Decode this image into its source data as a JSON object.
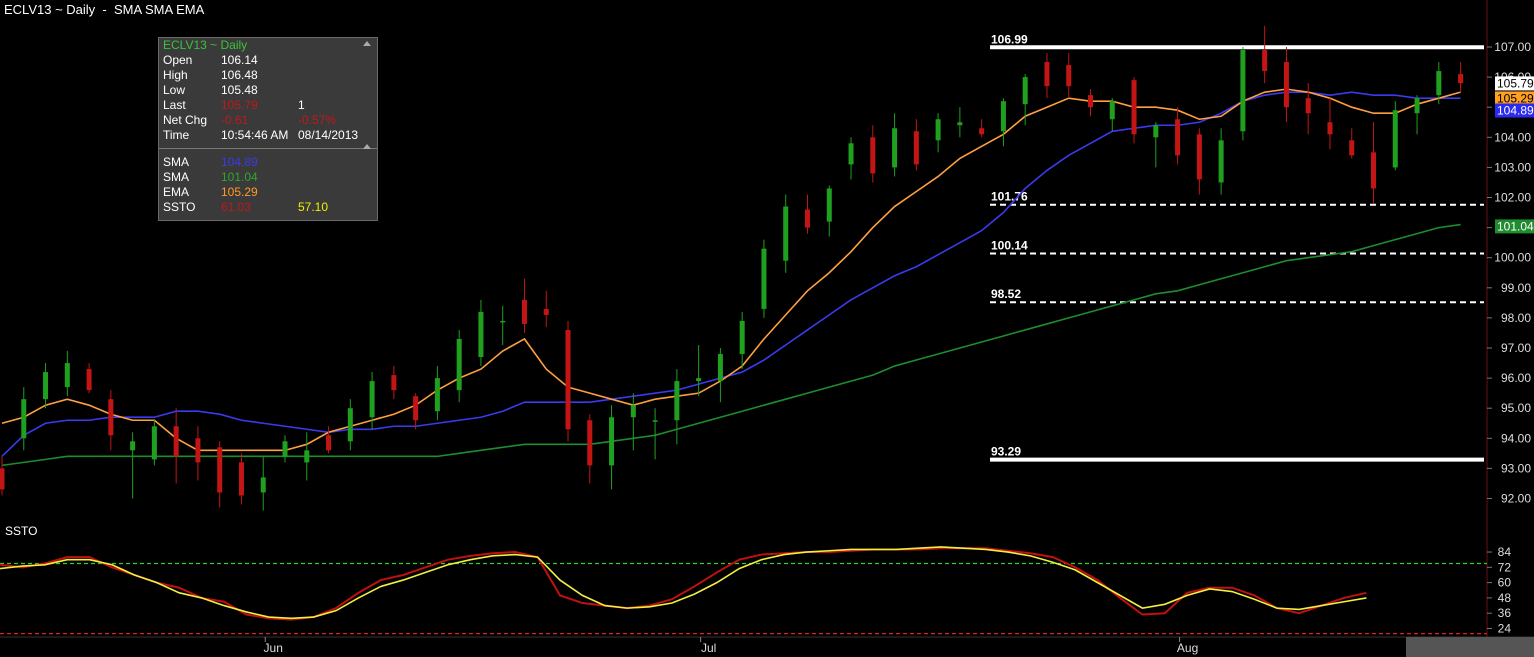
{
  "window": {
    "title": "ECLV13 ~ Daily  -  SMA SMA EMA"
  },
  "quote_box": {
    "header": "ECLV13 ~ Daily",
    "rows": [
      {
        "label": "Open",
        "v1": "106.14",
        "v2": ""
      },
      {
        "label": "High",
        "v1": "106.48",
        "v2": ""
      },
      {
        "label": "Low",
        "v1": "105.48",
        "v2": ""
      },
      {
        "label": "Last",
        "v1": "105.79",
        "v2": "1"
      },
      {
        "label": "Net Chg",
        "v1": "-0.61",
        "v2": "-0.57%"
      },
      {
        "label": "Time",
        "v1": "10:54:46 AM",
        "v2": "08/14/2013"
      }
    ],
    "studies": [
      {
        "label": "SMA",
        "v1": "104.89",
        "v2": ""
      },
      {
        "label": "SMA",
        "v1": "101.04",
        "v2": ""
      },
      {
        "label": "EMA",
        "v1": "105.29",
        "v2": ""
      },
      {
        "label": "SSTO",
        "v1": "61.03",
        "v2": "57.10"
      }
    ]
  },
  "ssto_panel": {
    "label": "SSTO"
  },
  "colors": {
    "up": "#1fa01f",
    "down": "#c41515",
    "sma_fast": "#3a3af0",
    "sma_slow": "#1f8c2e",
    "ema": "#ffa040",
    "ssto_k": "#c01010",
    "ssto_d": "#f0f040",
    "ob_line": "#2ed02e",
    "os_line": "#e02020"
  },
  "chart_data": [
    {
      "type": "candlestick",
      "title": "ECLV13 ~ Daily",
      "ylim": [
        91.3,
        107.9
      ],
      "x_labels": [
        {
          "i": 12,
          "label": "Jun"
        },
        {
          "i": 32,
          "label": "Jul"
        },
        {
          "i": 54,
          "label": "Aug"
        }
      ],
      "y_ticks": [
        92,
        93,
        94,
        95,
        96,
        97,
        98,
        99,
        100,
        101,
        102,
        103,
        104,
        105,
        106,
        107
      ],
      "candles": [
        {
          "o": 93.0,
          "h": 93.4,
          "l": 92.1,
          "c": 92.3
        },
        {
          "o": 94.0,
          "h": 95.7,
          "l": 93.6,
          "c": 95.3
        },
        {
          "o": 95.3,
          "h": 96.5,
          "l": 95.0,
          "c": 96.2
        },
        {
          "o": 95.7,
          "h": 96.9,
          "l": 95.4,
          "c": 96.5
        },
        {
          "o": 96.3,
          "h": 96.5,
          "l": 95.5,
          "c": 95.6
        },
        {
          "o": 95.3,
          "h": 95.6,
          "l": 93.6,
          "c": 94.1
        },
        {
          "o": 93.6,
          "h": 94.2,
          "l": 92.0,
          "c": 93.9
        },
        {
          "o": 93.3,
          "h": 94.6,
          "l": 93.1,
          "c": 94.4
        },
        {
          "o": 94.4,
          "h": 95.0,
          "l": 92.5,
          "c": 93.4
        },
        {
          "o": 94.0,
          "h": 94.4,
          "l": 92.6,
          "c": 93.2
        },
        {
          "o": 93.7,
          "h": 93.9,
          "l": 91.7,
          "c": 92.2
        },
        {
          "o": 93.2,
          "h": 93.5,
          "l": 91.8,
          "c": 92.1
        },
        {
          "o": 92.2,
          "h": 93.4,
          "l": 91.6,
          "c": 92.7
        },
        {
          "o": 93.4,
          "h": 94.1,
          "l": 93.2,
          "c": 93.9
        },
        {
          "o": 93.2,
          "h": 94.2,
          "l": 92.6,
          "c": 93.6
        },
        {
          "o": 94.1,
          "h": 94.4,
          "l": 93.5,
          "c": 93.6
        },
        {
          "o": 93.9,
          "h": 95.3,
          "l": 93.6,
          "c": 95.0
        },
        {
          "o": 94.7,
          "h": 96.2,
          "l": 94.3,
          "c": 95.9
        },
        {
          "o": 96.1,
          "h": 96.4,
          "l": 95.3,
          "c": 95.6
        },
        {
          "o": 95.4,
          "h": 95.5,
          "l": 94.3,
          "c": 94.6
        },
        {
          "o": 94.9,
          "h": 96.4,
          "l": 94.6,
          "c": 96.0
        },
        {
          "o": 95.6,
          "h": 97.6,
          "l": 95.2,
          "c": 97.3
        },
        {
          "o": 96.7,
          "h": 98.6,
          "l": 96.4,
          "c": 98.2
        },
        {
          "o": 97.9,
          "h": 98.4,
          "l": 97.1,
          "c": 97.9
        },
        {
          "o": 98.6,
          "h": 99.3,
          "l": 97.5,
          "c": 97.8
        },
        {
          "o": 98.3,
          "h": 98.9,
          "l": 97.7,
          "c": 98.1
        },
        {
          "o": 97.6,
          "h": 97.9,
          "l": 93.9,
          "c": 94.3
        },
        {
          "o": 94.6,
          "h": 94.8,
          "l": 92.5,
          "c": 93.1
        },
        {
          "o": 93.1,
          "h": 95.1,
          "l": 92.3,
          "c": 94.7
        },
        {
          "o": 94.7,
          "h": 95.5,
          "l": 93.6,
          "c": 95.1
        },
        {
          "o": 94.6,
          "h": 95.0,
          "l": 93.3,
          "c": 94.6
        },
        {
          "o": 94.6,
          "h": 96.3,
          "l": 93.8,
          "c": 95.9
        },
        {
          "o": 95.9,
          "h": 97.1,
          "l": 95.4,
          "c": 96.0
        },
        {
          "o": 95.9,
          "h": 97.0,
          "l": 95.2,
          "c": 96.8
        },
        {
          "o": 96.8,
          "h": 98.2,
          "l": 96.3,
          "c": 97.9
        },
        {
          "o": 98.3,
          "h": 100.6,
          "l": 98.0,
          "c": 100.3
        },
        {
          "o": 99.9,
          "h": 102.1,
          "l": 99.5,
          "c": 101.7
        },
        {
          "o": 101.6,
          "h": 102.1,
          "l": 100.8,
          "c": 101.0
        },
        {
          "o": 101.2,
          "h": 102.4,
          "l": 100.7,
          "c": 102.3
        },
        {
          "o": 103.1,
          "h": 104.0,
          "l": 102.6,
          "c": 103.8
        },
        {
          "o": 104.0,
          "h": 104.4,
          "l": 102.5,
          "c": 102.8
        },
        {
          "o": 103.0,
          "h": 104.8,
          "l": 102.7,
          "c": 104.3
        },
        {
          "o": 104.2,
          "h": 104.6,
          "l": 102.9,
          "c": 103.1
        },
        {
          "o": 103.9,
          "h": 104.8,
          "l": 103.5,
          "c": 104.6
        },
        {
          "o": 104.4,
          "h": 105.0,
          "l": 104.0,
          "c": 104.5
        },
        {
          "o": 104.3,
          "h": 104.6,
          "l": 104.0,
          "c": 104.1
        },
        {
          "o": 104.2,
          "h": 105.3,
          "l": 103.7,
          "c": 105.2
        },
        {
          "o": 105.1,
          "h": 106.1,
          "l": 104.4,
          "c": 106.0
        },
        {
          "o": 106.5,
          "h": 106.8,
          "l": 105.3,
          "c": 105.7
        },
        {
          "o": 106.4,
          "h": 106.8,
          "l": 105.3,
          "c": 105.7
        },
        {
          "o": 105.4,
          "h": 105.6,
          "l": 104.7,
          "c": 105.0
        },
        {
          "o": 104.6,
          "h": 105.3,
          "l": 104.2,
          "c": 105.2
        },
        {
          "o": 105.9,
          "h": 106.0,
          "l": 103.8,
          "c": 104.1
        },
        {
          "o": 104.0,
          "h": 104.5,
          "l": 103.0,
          "c": 104.4
        },
        {
          "o": 104.6,
          "h": 105.0,
          "l": 103.1,
          "c": 103.4
        },
        {
          "o": 104.1,
          "h": 104.3,
          "l": 102.1,
          "c": 102.6
        },
        {
          "o": 102.5,
          "h": 104.3,
          "l": 102.1,
          "c": 103.9
        },
        {
          "o": 104.2,
          "h": 107.0,
          "l": 103.9,
          "c": 106.9
        },
        {
          "o": 106.9,
          "h": 107.7,
          "l": 105.8,
          "c": 106.2
        },
        {
          "o": 106.5,
          "h": 107.0,
          "l": 104.5,
          "c": 105.0
        },
        {
          "o": 105.3,
          "h": 105.8,
          "l": 104.1,
          "c": 104.8
        },
        {
          "o": 104.5,
          "h": 105.3,
          "l": 103.6,
          "c": 104.1
        },
        {
          "o": 103.9,
          "h": 104.3,
          "l": 103.3,
          "c": 103.4
        },
        {
          "o": 103.5,
          "h": 104.5,
          "l": 101.8,
          "c": 102.3
        },
        {
          "o": 103.0,
          "h": 105.2,
          "l": 102.9,
          "c": 104.9
        },
        {
          "o": 104.8,
          "h": 105.4,
          "l": 104.1,
          "c": 105.3
        },
        {
          "o": 105.4,
          "h": 106.5,
          "l": 105.1,
          "c": 106.2
        },
        {
          "o": 106.1,
          "h": 106.5,
          "l": 105.5,
          "c": 105.8
        }
      ],
      "sma_fast": [
        93.4,
        94.1,
        94.5,
        94.6,
        94.6,
        94.7,
        94.7,
        94.7,
        94.9,
        94.9,
        94.8,
        94.6,
        94.5,
        94.4,
        94.3,
        94.2,
        94.3,
        94.3,
        94.4,
        94.4,
        94.5,
        94.6,
        94.7,
        94.9,
        95.2,
        95.2,
        95.2,
        95.2,
        95.3,
        95.4,
        95.5,
        95.6,
        95.8,
        96.0,
        96.2,
        96.6,
        97.1,
        97.6,
        98.1,
        98.6,
        99.0,
        99.4,
        99.7,
        100.1,
        100.5,
        100.9,
        101.5,
        102.3,
        102.9,
        103.4,
        103.8,
        104.2,
        104.3,
        104.4,
        104.4,
        104.5,
        104.8,
        105.2,
        105.4,
        105.5,
        105.5,
        105.4,
        105.5,
        105.4,
        105.4,
        105.3,
        105.3,
        105.3
      ],
      "sma_slow": [
        93.1,
        93.2,
        93.3,
        93.4,
        93.4,
        93.4,
        93.4,
        93.4,
        93.4,
        93.4,
        93.4,
        93.4,
        93.4,
        93.4,
        93.4,
        93.4,
        93.4,
        93.4,
        93.4,
        93.4,
        93.4,
        93.5,
        93.6,
        93.7,
        93.8,
        93.8,
        93.8,
        93.8,
        93.9,
        94.0,
        94.1,
        94.3,
        94.5,
        94.7,
        94.9,
        95.1,
        95.3,
        95.5,
        95.7,
        95.9,
        96.1,
        96.4,
        96.6,
        96.8,
        97.0,
        97.2,
        97.4,
        97.6,
        97.8,
        98.0,
        98.2,
        98.4,
        98.6,
        98.8,
        98.9,
        99.1,
        99.3,
        99.5,
        99.7,
        99.9,
        100.0,
        100.1,
        100.2,
        100.4,
        100.6,
        100.8,
        101.0,
        101.1
      ],
      "ema": [
        94.5,
        94.7,
        95.1,
        95.3,
        95.1,
        94.8,
        94.6,
        94.6,
        94.0,
        93.6,
        93.6,
        93.6,
        93.6,
        93.6,
        93.8,
        94.2,
        94.4,
        94.6,
        94.8,
        95.1,
        95.6,
        96.0,
        96.3,
        96.9,
        97.3,
        96.3,
        95.7,
        95.5,
        95.3,
        95.1,
        95.3,
        95.4,
        95.5,
        95.9,
        96.4,
        97.3,
        98.1,
        98.9,
        99.5,
        100.2,
        101.0,
        101.7,
        102.2,
        102.7,
        103.3,
        103.7,
        104.1,
        104.7,
        105.0,
        105.3,
        105.2,
        105.2,
        105.0,
        105.0,
        104.9,
        104.6,
        104.7,
        105.2,
        105.5,
        105.6,
        105.5,
        105.3,
        105.0,
        104.8,
        104.8,
        105.1,
        105.3,
        105.5
      ],
      "levels": [
        {
          "value": 106.99,
          "label": "106.99",
          "style": "solid"
        },
        {
          "value": 101.76,
          "label": "101.76",
          "style": "dashed"
        },
        {
          "value": 100.14,
          "label": "100.14",
          "style": "dashed"
        },
        {
          "value": 98.52,
          "label": "98.52",
          "style": "dashed"
        },
        {
          "value": 93.29,
          "label": "93.29",
          "style": "solid"
        }
      ],
      "price_tags": [
        {
          "value": 105.79,
          "label": "105.79",
          "bg": "#ffffff",
          "fg": "#000000"
        },
        {
          "value": 105.29,
          "label": "105.29",
          "bg": "#ffa020",
          "fg": "#000000"
        },
        {
          "value": 104.89,
          "label": "104.89",
          "bg": "#2a2af0",
          "fg": "#ffffff"
        },
        {
          "value": 101.04,
          "label": "101.04",
          "bg": "#1f8c2e",
          "fg": "#ffffff"
        }
      ]
    },
    {
      "type": "line",
      "title": "SSTO",
      "ylim": [
        15,
        95
      ],
      "y_ticks": [
        84,
        72,
        60,
        48,
        36,
        24
      ],
      "k_line": [
        74,
        72,
        75,
        80,
        80,
        72,
        66,
        60,
        56,
        48,
        45,
        35,
        32,
        31,
        33,
        40,
        52,
        62,
        66,
        72,
        78,
        81,
        83,
        84,
        80,
        50,
        44,
        42,
        40,
        42,
        47,
        57,
        68,
        78,
        82,
        83,
        84,
        84,
        85,
        86,
        86,
        86,
        87,
        87,
        87,
        85,
        83,
        80,
        72,
        62,
        48,
        35,
        36,
        52,
        56,
        56,
        50,
        40,
        36,
        42,
        48,
        52
      ],
      "d_line": [
        71,
        73,
        74,
        78,
        78,
        74,
        66,
        60,
        52,
        48,
        42,
        37,
        33,
        32,
        33,
        38,
        48,
        57,
        62,
        68,
        74,
        78,
        81,
        82,
        80,
        62,
        50,
        42,
        40,
        41,
        44,
        51,
        60,
        71,
        78,
        82,
        84,
        85,
        86,
        86,
        86,
        87,
        88,
        87,
        86,
        84,
        81,
        76,
        70,
        60,
        50,
        40,
        43,
        50,
        55,
        53,
        47,
        40,
        39,
        42,
        45,
        48
      ],
      "overbought": 75,
      "oversold": 20
    }
  ]
}
